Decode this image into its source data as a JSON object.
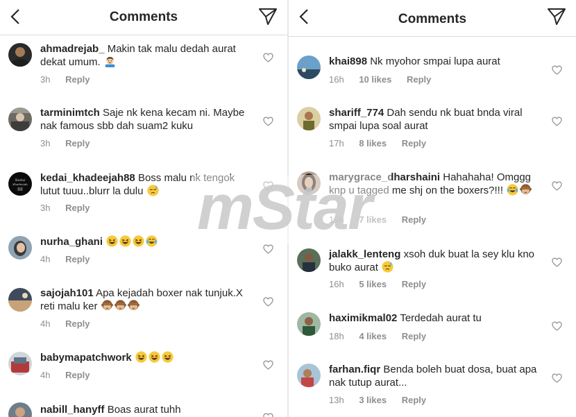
{
  "left": {
    "title": "Comments",
    "comments": [
      {
        "user": "ahmadrejab_",
        "text": "Makin tak malu dedah aurat dekat umum.",
        "time": "3h",
        "reply": "Reply"
      },
      {
        "user": "tarminimtch",
        "text": "Saje nk kena kecam ni. Maybe nak famous sbb dah suam2 kuku",
        "time": "3h",
        "reply": "Reply"
      },
      {
        "user": "kedai_khadeejah88",
        "text": "Boss malu nk tengok lutut tuuu..blurr la dulu",
        "time": "3h",
        "reply": "Reply"
      },
      {
        "user": "nurha_ghani",
        "text": "",
        "time": "4h",
        "reply": "Reply"
      },
      {
        "user": "sajojah101",
        "text": "Apa kejadah boxer nak tunjuk.X reti malu ker",
        "time": "4h",
        "reply": "Reply"
      },
      {
        "user": "babymapatchwork",
        "text": "",
        "time": "4h",
        "reply": "Reply"
      },
      {
        "user": "nabill_hanyff",
        "text": "Boas aurat tuhh",
        "time": "",
        "reply": ""
      }
    ]
  },
  "right": {
    "title": "Comments",
    "comments": [
      {
        "user": "khai898",
        "text": "Nk myohor smpai lupa aurat",
        "time": "16h",
        "likes": "10 likes",
        "reply": "Reply"
      },
      {
        "user": "shariff_774",
        "text": "Dah sendu nk buat bnda viral smpai lupa soal aurat",
        "time": "17h",
        "likes": "8 likes",
        "reply": "Reply"
      },
      {
        "user": "marygrace_dharshaini",
        "text": "Hahahaha! Omggg knp u tagged me shj on the boxers?!!!",
        "time": "19h",
        "likes": "7 likes",
        "reply": "Reply"
      },
      {
        "user": "jalakk_lenteng",
        "text": "xsoh duk buat la sey klu kno buko aurat",
        "time": "16h",
        "likes": "5 likes",
        "reply": "Reply"
      },
      {
        "user": "haximikmal02",
        "text": "Terdedah aurat tu",
        "time": "18h",
        "likes": "4 likes",
        "reply": "Reply"
      },
      {
        "user": "farhan.fiqr",
        "text": "Benda boleh buat dosa, buat apa nak tutup aurat...",
        "time": "13h",
        "likes": "3 likes",
        "reply": "Reply"
      }
    ]
  },
  "watermark": "mStar",
  "icons": {
    "back": "chevron-left-icon",
    "send": "paper-plane-icon",
    "like": "heart-outline-icon"
  },
  "colors": {
    "text": "#262626",
    "secondary": "#8e8e8e",
    "divider": "#dbdbdb"
  }
}
